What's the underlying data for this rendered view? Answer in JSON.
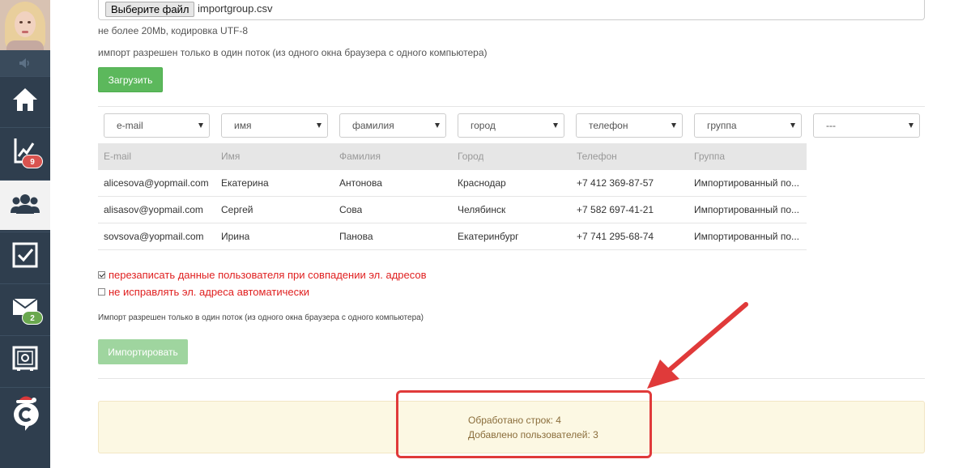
{
  "sidebar": {
    "notifications": {
      "analytics_badge": "9",
      "mail_badge": "2"
    },
    "icons": [
      "home-icon",
      "chart-icon",
      "users-icon",
      "tasks-icon",
      "mail-icon",
      "safe-icon",
      "logo-icon"
    ]
  },
  "upload": {
    "choose_file_label": "Выберите файл",
    "file_name": "importgroup.csv",
    "size_hint": "не более 20Mb, кодировка UTF-8",
    "thread_hint": "импорт разрешен только в один поток (из одного окна браузера с одного компьютера)",
    "upload_button": "Загрузить"
  },
  "mapping": {
    "selects": [
      "e-mail",
      "имя",
      "фамилия",
      "город",
      "телефон",
      "группа",
      "---"
    ]
  },
  "table": {
    "headers": [
      "E-mail",
      "Имя",
      "Фамилия",
      "Город",
      "Телефон",
      "Группа"
    ],
    "rows": [
      [
        "alicesova@yopmail.com",
        "Екатерина",
        "Антонова",
        "Краснодар",
        "+7 412 369-87-57",
        "Импортированный по..."
      ],
      [
        "alisasov@yopmail.com",
        "Сергей",
        "Сова",
        "Челябинск",
        "+7 582 697-41-21",
        "Импортированный по..."
      ],
      [
        "sovsova@yopmail.com",
        "Ирина",
        "Панова",
        "Екатеринбург",
        "+7 741 295-68-74",
        "Импортированный по..."
      ]
    ]
  },
  "options": {
    "overwrite_label": "перезаписать данные пользователя при совпадении эл. адресов",
    "overwrite_checked": true,
    "no_fix_label": "не исправлять эл. адреса автоматически",
    "no_fix_checked": false
  },
  "import": {
    "note": "Импорт разрешен только в один поток (из одного окна браузера с одного компьютера)",
    "button": "Импортировать"
  },
  "result": {
    "processed": "Обработано строк: 4",
    "added": "Добавлено пользователей: 3"
  },
  "colors": {
    "sidebar": "#2f3e4e",
    "accent_green": "#5cb85c",
    "alert_red": "#e03a3a",
    "result_bg": "#fcf8e3"
  }
}
